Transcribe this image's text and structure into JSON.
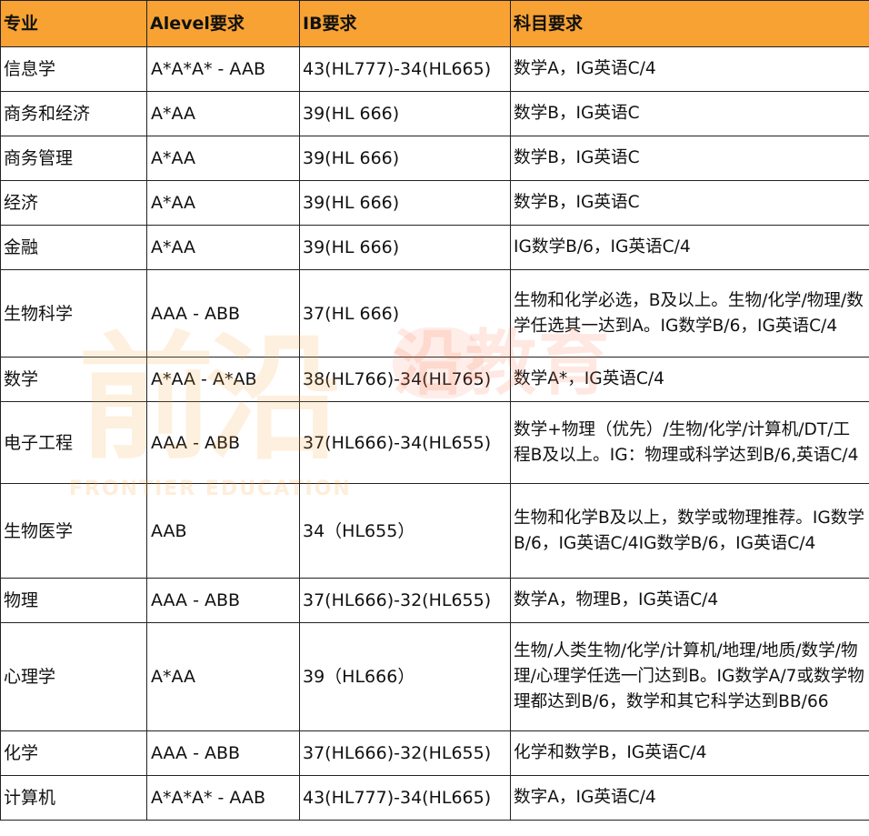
{
  "header": {
    "major": "专业",
    "alevel": "Alevel要求",
    "ib": "IB要求",
    "subjects": "科目要求"
  },
  "rows": [
    {
      "major": "信息学",
      "alevel": "A*A*A* - AAB",
      "ib": "43(HL777)-34(HL665)",
      "subjects": "数学A，IG英语C/4"
    },
    {
      "major": "商务和经济",
      "alevel": " A*AA",
      "ib": "39(HL 666)",
      "subjects": "数学B，IG英语C"
    },
    {
      "major": "商务管理",
      "alevel": " A*AA",
      "ib": "39(HL 666)",
      "subjects": "数学B，IG英语C"
    },
    {
      "major": "经济",
      "alevel": " A*AA",
      "ib": "39(HL 666)",
      "subjects": "数学B，IG英语C"
    },
    {
      "major": "金融",
      "alevel": " A*AA",
      "ib": "39(HL 666)",
      "subjects": "IG数学B/6，IG英语C/4"
    },
    {
      "major": "生物科学",
      "alevel": " AAA - ABB",
      "ib": "37(HL 666)",
      "subjects": "生物和化学必选，B及以上。生物/化学/物理/数学任选其一达到A。IG数学B/6，IG英语C/4"
    },
    {
      "major": "数学",
      "alevel": "A*AA - A*AB",
      "ib": "38(HL766)-34(HL765)",
      "subjects": "数学A*，IG英语C/4"
    },
    {
      "major": "电子工程",
      "alevel": " AAA - ABB",
      "ib": "37(HL666)-34(HL655)",
      "subjects": "数学+物理（优先）/生物/化学/计算机/DT/工程B及以上。IG：物理或科学达到B/6,英语C/4"
    },
    {
      "major": "生物医学",
      "alevel": " AAB",
      "ib": "34（HL655）",
      "subjects": "生物和化学B及以上，数学或物理推荐。IG数学B/6，IG英语C/4IG数学B/6，IG英语C/4"
    },
    {
      "major": "物理",
      "alevel": "AAA - ABB",
      "ib": "37(HL666)-32(HL655)",
      "subjects": "数学A，物理B，IG英语C/4"
    },
    {
      "major": "心理学",
      "alevel": "A*AA",
      "ib": "39（HL666）",
      "subjects": "生物/人类生物/化学/计算机/地理/地质/数学/物理/心理学任选一门达到B。IG数学A/7或数学物理都达到B/6，数学和其它科学达到BB/66"
    },
    {
      "major": "化学",
      "alevel": " AAA - ABB",
      "ib": "37(HL666)-32(HL655)",
      "subjects": "化学和数学B，IG英语C/4"
    },
    {
      "major": "计算机",
      "alevel": "A*A*A* - AAB",
      "ib": "43(HL777)-34(HL665)",
      "subjects": "数字A，IG英语C/4"
    }
  ],
  "watermark": {
    "left_logo": "前沿",
    "left_sub": "FRONTIER EDUCATION",
    "right_logo": "沿教育"
  },
  "colors": {
    "header_bg": "#f7a233",
    "border": "#222222",
    "text": "#111111"
  }
}
